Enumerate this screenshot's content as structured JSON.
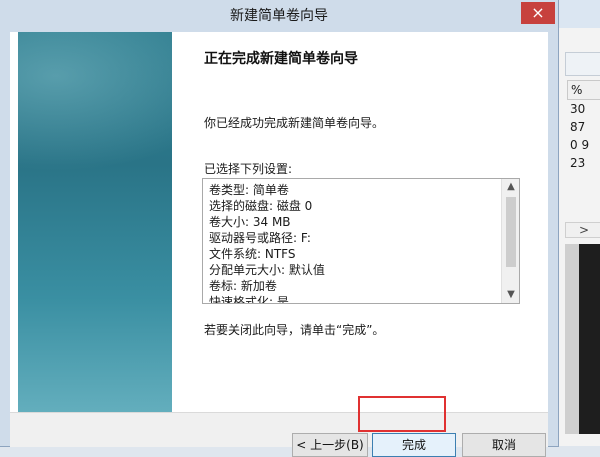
{
  "window": {
    "title": "新建简单卷向导",
    "close_label": "×"
  },
  "wizard": {
    "heading": "正在完成新建简单卷向导",
    "intro": "你已经成功完成新建简单卷向导。",
    "settings_label": "已选择下列设置:",
    "settings": [
      "卷类型: 简单卷",
      "选择的磁盘: 磁盘 0",
      "卷大小: 34 MB",
      "驱动器号或路径: F:",
      "文件系统: NTFS",
      "分配单元大小: 默认值",
      "卷标: 新加卷",
      "快速格式化: 是"
    ],
    "close_hint": "若要关闭此向导，请单击“完成”。"
  },
  "buttons": {
    "back": "< 上一步(B)",
    "finish": "完成",
    "cancel": "取消"
  },
  "background_window": {
    "column_header": "%",
    "values": [
      "30",
      "87",
      "0 9",
      "23"
    ],
    "scroll_glyph": ">"
  },
  "colors": {
    "highlight": "#e03131",
    "close": "#c7413d"
  }
}
